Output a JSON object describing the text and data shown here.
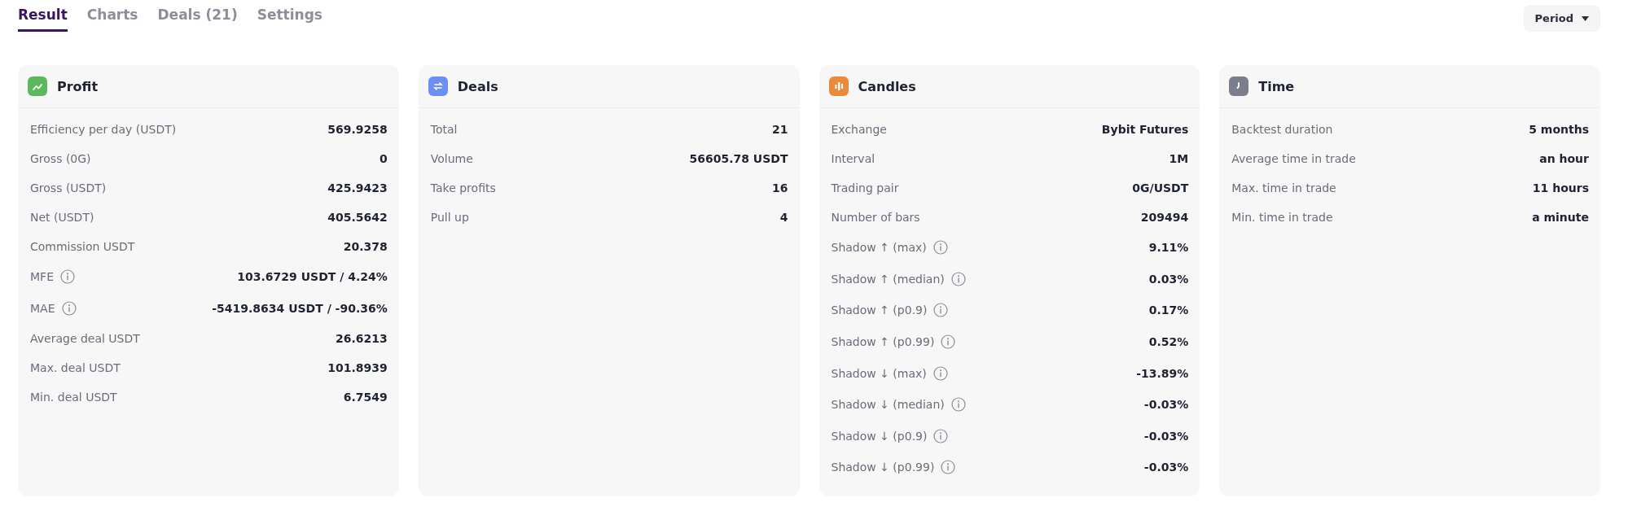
{
  "tabs": [
    {
      "label": "Result",
      "selected": true
    },
    {
      "label": "Charts",
      "selected": false
    },
    {
      "label": "Deals (21)",
      "selected": false
    },
    {
      "label": "Settings",
      "selected": false
    }
  ],
  "period_button": {
    "label": "Period"
  },
  "cards": [
    {
      "title": "Profit",
      "kind": "trend",
      "color": "#5cb85c",
      "rows": [
        {
          "label": "Efficiency per day (USDT)",
          "value": "569.9258",
          "info": false
        },
        {
          "label": "Gross (0G)",
          "value": "0",
          "info": false
        },
        {
          "label": "Gross (USDT)",
          "value": "425.9423",
          "info": false
        },
        {
          "label": "Net (USDT)",
          "value": "405.5642",
          "info": false
        },
        {
          "label": "Commission USDT",
          "value": "20.378",
          "info": false
        },
        {
          "label": "MFE",
          "value": "103.6729 USDT / 4.24%",
          "info": true
        },
        {
          "label": "MAE",
          "value": "-5419.8634 USDT / -90.36%",
          "info": true
        },
        {
          "label": "Average deal USDT",
          "value": "26.6213",
          "info": false
        },
        {
          "label": "Max. deal USDT",
          "value": "101.8939",
          "info": false
        },
        {
          "label": "Min. deal USDT",
          "value": "6.7549",
          "info": false
        }
      ]
    },
    {
      "title": "Deals",
      "kind": "swap",
      "color": "#6d8ef3",
      "rows": [
        {
          "label": "Total",
          "value": "21",
          "info": false
        },
        {
          "label": "Volume",
          "value": "56605.78 USDT",
          "info": false
        },
        {
          "label": "Take profits",
          "value": "16",
          "info": false
        },
        {
          "label": "Pull up",
          "value": "4",
          "info": false
        }
      ]
    },
    {
      "title": "Candles",
      "kind": "candles",
      "color": "#ea8a3c",
      "rows": [
        {
          "label": "Exchange",
          "value": "Bybit Futures",
          "info": false
        },
        {
          "label": "Interval",
          "value": "1M",
          "info": false
        },
        {
          "label": "Trading pair",
          "value": "0G/USDT",
          "info": false
        },
        {
          "label": "Number of bars",
          "value": "209494",
          "info": false
        },
        {
          "label": "Shadow ↑ (max)",
          "value": "9.11%",
          "info": true
        },
        {
          "label": "Shadow ↑ (median)",
          "value": "0.03%",
          "info": true
        },
        {
          "label": "Shadow ↑ (p0.9)",
          "value": "0.17%",
          "info": true
        },
        {
          "label": "Shadow ↑ (p0.99)",
          "value": "0.52%",
          "info": true
        },
        {
          "label": "Shadow ↓ (max)",
          "value": "-13.89%",
          "info": true
        },
        {
          "label": "Shadow ↓ (median)",
          "value": "-0.03%",
          "info": true
        },
        {
          "label": "Shadow ↓ (p0.9)",
          "value": "-0.03%",
          "info": true
        },
        {
          "label": "Shadow ↓ (p0.99)",
          "value": "-0.03%",
          "info": true
        }
      ]
    },
    {
      "title": "Time",
      "kind": "clock",
      "color": "#7b7e8c",
      "rows": [
        {
          "label": "Backtest duration",
          "value": "5 months",
          "info": false
        },
        {
          "label": "Average time in trade",
          "value": "an hour",
          "info": false
        },
        {
          "label": "Max. time in trade",
          "value": "11 hours",
          "info": false
        },
        {
          "label": "Min. time in trade",
          "value": "a minute",
          "info": false
        }
      ]
    }
  ]
}
